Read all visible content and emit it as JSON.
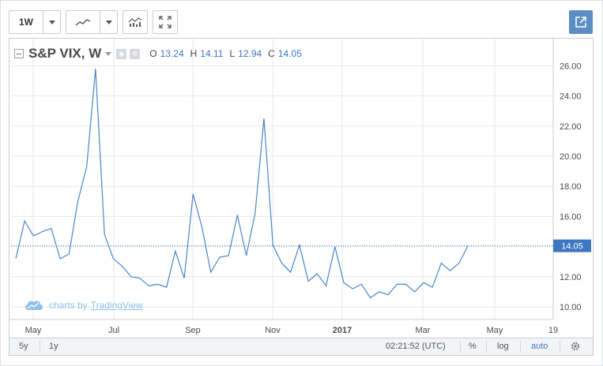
{
  "toolbar": {
    "interval_label": "1W",
    "interval_caret_icon": "chevron-down-icon",
    "chart_style_icon": "line-chart-icon",
    "chart_style_caret_icon": "chevron-down-icon",
    "indicators_icon": "indicators-icon",
    "fullscreen_icon": "fullscreen-icon",
    "popout_icon": "popout-icon"
  },
  "legend": {
    "symbol": "S&P VIX, W",
    "o_label": "O",
    "o_value": "13.24",
    "h_label": "H",
    "h_value": "14.11",
    "l_label": "L",
    "l_value": "12.94",
    "c_label": "C",
    "c_value": "14.05"
  },
  "watermark": {
    "prefix": "charts by",
    "brand": "TradingView"
  },
  "bottom_bar": {
    "range_5y": "5y",
    "range_1y": "1y",
    "time": "02:21:52 (UTC)",
    "percent": "%",
    "log": "log",
    "auto": "auto"
  },
  "colors": {
    "line": "#4a86c8",
    "price_tag": "#3d77c1",
    "grid": "#e6e8eb",
    "accent": "#5b8ec4"
  },
  "chart_data": {
    "type": "line",
    "title": "S&P VIX, W",
    "xlabel": "",
    "ylabel": "",
    "grid": true,
    "x_tick_labels": [
      "May",
      "Jul",
      "Sep",
      "Nov",
      "2017",
      "Mar",
      "May",
      "19"
    ],
    "y_tick_labels": [
      "10.00",
      "12.00",
      "14.00",
      "16.00",
      "18.00",
      "20.00",
      "22.00",
      "24.00",
      "26.00"
    ],
    "ylim": [
      9.3,
      27.2
    ],
    "last_value_label": "14.05",
    "series": [
      {
        "values": [
          13.2,
          15.7,
          14.7,
          15.0,
          15.2,
          13.2,
          13.5,
          17.0,
          19.3,
          25.8,
          14.8,
          13.2,
          12.7,
          12.0,
          11.9,
          11.4,
          11.5,
          11.3,
          13.7,
          11.9,
          17.5,
          15.3,
          12.3,
          13.3,
          13.4,
          16.1,
          13.4,
          16.2,
          22.5,
          14.1,
          12.9,
          12.3,
          14.1,
          11.7,
          12.2,
          11.4,
          14.0,
          11.6,
          11.2,
          11.5,
          10.6,
          11.0,
          10.8,
          11.5,
          11.5,
          11.0,
          11.6,
          11.3,
          12.9,
          12.4,
          12.9,
          14.05
        ]
      }
    ]
  }
}
